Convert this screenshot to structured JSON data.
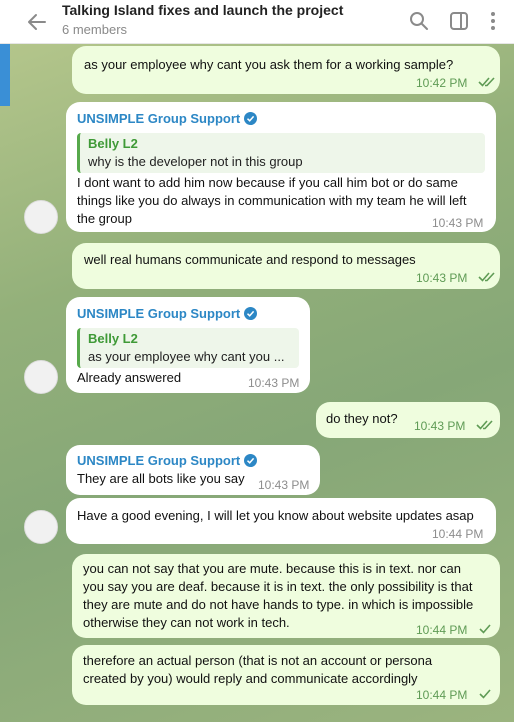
{
  "header": {
    "title": "Talking Island fixes and launch the project",
    "subtitle": "6 members",
    "icons": [
      "back-arrow-icon",
      "search-icon",
      "sidebar-toggle-icon",
      "more-vertical-icon"
    ]
  },
  "colors": {
    "outgoing_bubble": "#effdde",
    "incoming_bubble": "#ffffff",
    "sender_name": "#2c87c5",
    "quote_name": "#3f9a37",
    "accent": "#3a8fd6"
  },
  "messages": [
    {
      "type": "out",
      "text": "as your employee why cant you ask them for a working sample?",
      "time": "10:42 PM",
      "status": "read"
    },
    {
      "type": "in",
      "sender": "UNSIMPLE Group Support",
      "quote_name": "Belly L2",
      "quote_text": "why is the developer not in this group",
      "lines": [
        "I dont want to add him now because if you call him bot or do same",
        "things like you do always in communication with my team he will left",
        "the group"
      ],
      "time": "10:43 PM"
    },
    {
      "type": "out",
      "text": "well real humans communicate and respond to messages",
      "time": "10:43 PM",
      "status": "read"
    },
    {
      "type": "in",
      "sender": "UNSIMPLE Group Support",
      "quote_name": "Belly L2",
      "quote_text": "as your employee why cant you ...",
      "text": "Already answered",
      "time": "10:43 PM"
    },
    {
      "type": "out",
      "text": "do they not?",
      "time": "10:43 PM",
      "status": "read"
    },
    {
      "type": "in",
      "sender": "UNSIMPLE Group Support",
      "text": "They are all bots like you say",
      "time": "10:43 PM"
    },
    {
      "type": "in",
      "text": "Have a good evening, I will let you know about website updates asap",
      "time": "10:44 PM"
    },
    {
      "type": "out",
      "lines": [
        "you can not say that you are mute. because this is in text. nor can",
        "you say you are deaf. because it is in text. the only possibility is that",
        "they are mute and do not have hands to type. in which is impossible",
        "otherwise they can not work in tech."
      ],
      "time": "10:44 PM",
      "status": "sent"
    },
    {
      "type": "out",
      "lines": [
        "therefore an actual person (that is not an account or persona",
        "created by you) would reply and communicate accordingly"
      ],
      "time": "10:44 PM",
      "status": "sent"
    }
  ]
}
